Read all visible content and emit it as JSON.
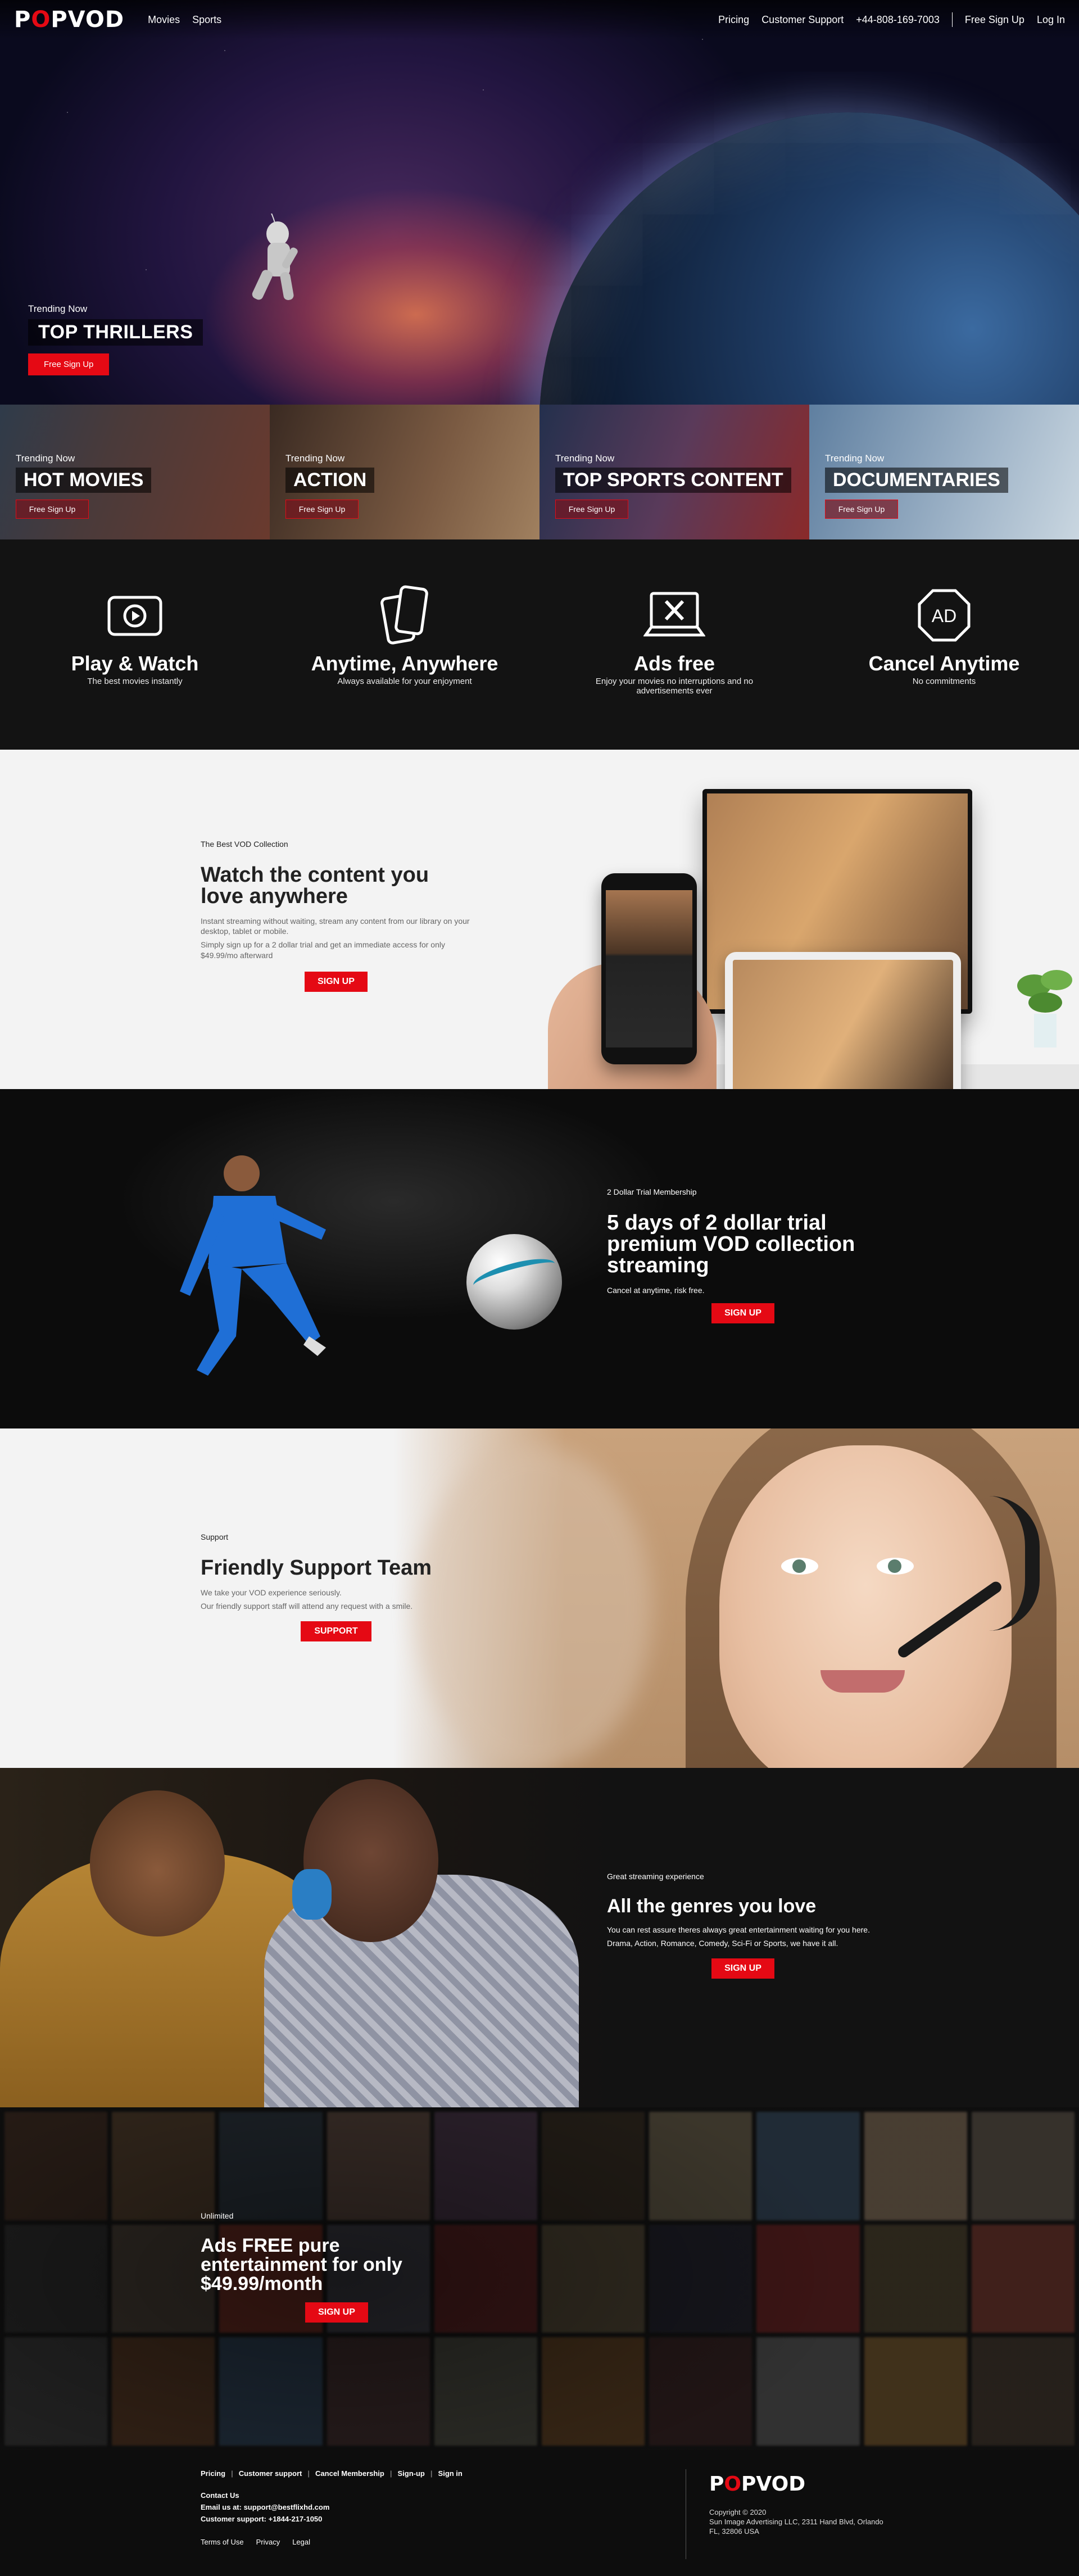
{
  "nav": {
    "logo_before": "P",
    "logo_o": "O",
    "logo_after": "PVOD",
    "links": [
      "Movies",
      "Sports"
    ],
    "right": {
      "pricing": "Pricing",
      "support": "Customer Support",
      "phone": "+44-808-169-7003",
      "signup": "Free Sign Up",
      "login": "Log In"
    }
  },
  "hero": {
    "label": "Trending Now",
    "title": "TOP THRILLERS",
    "button": "Free Sign Up"
  },
  "categories": [
    {
      "label": "Trending Now",
      "title": "HOT MOVIES",
      "button": "Free Sign Up",
      "colors": [
        "#2f3b4a",
        "#6a3a2e"
      ]
    },
    {
      "label": "Trending Now",
      "title": "ACTION",
      "button": "Free Sign Up",
      "colors": [
        "#3a2a22",
        "#a0805f"
      ]
    },
    {
      "label": "Trending Now",
      "title": "TOP SPORTS CONTENT",
      "button": "Free Sign Up",
      "colors": [
        "#24304d",
        "#8a2a2a"
      ]
    },
    {
      "label": "Trending Now",
      "title": "DOCUMENTARIES",
      "button": "Free Sign Up",
      "colors": [
        "#5f7fa0",
        "#c9d6e0"
      ]
    }
  ],
  "features": [
    {
      "icon": "play-icon",
      "title": "Play & Watch",
      "sub": "The best movies instantly"
    },
    {
      "icon": "devices-icon",
      "title": "Anytime, Anywhere",
      "sub": "Always available for your enjoyment"
    },
    {
      "icon": "no-ads-icon",
      "title": "Ads free",
      "sub": "Enjoy your movies no interruptions and no advertisements ever"
    },
    {
      "icon": "ad-octagon-icon",
      "title": "Cancel Anytime",
      "sub": "No commitments"
    }
  ],
  "section_content": {
    "eyebrow": "The Best VOD Collection",
    "heading": "Watch the content you love anywhere",
    "p1": "Instant streaming without waiting, stream any content from our library on your desktop, tablet or mobile.",
    "p2": "Simply sign up for a 2 dollar trial and get an immediate access for only $49.99/mo afterward",
    "button": "SIGN UP"
  },
  "section_trial": {
    "eyebrow": "2 Dollar Trial Membership",
    "heading": "5 days of 2 dollar trial premium VOD collection streaming",
    "p1": "Cancel at anytime, risk free.",
    "button": "SIGN UP"
  },
  "section_support": {
    "eyebrow": "Support",
    "heading": "Friendly Support Team",
    "p1": "We take your VOD experience seriously.",
    "p2": "Our friendly support staff will attend any request with a smile.",
    "button": "SUPPORT"
  },
  "section_genres": {
    "eyebrow": "Great streaming experience",
    "heading": "All the genres you love",
    "p1": "You can rest assure theres always great entertainment waiting for you here.",
    "p2": "Drama, Action, Romance, Comedy, Sci-Fi or Sports, we have it all.",
    "button": "SIGN UP"
  },
  "section_unlimited": {
    "eyebrow": "Unlimited",
    "heading": "Ads FREE pure entertainment for only $49.99/month",
    "button": "SIGN UP"
  },
  "footer": {
    "links": [
      "Pricing",
      "Customer support",
      "Cancel Membership",
      "Sign-up",
      "Sign in"
    ],
    "contact_heading": "Contact Us",
    "email": "Email us at: support@bestflixhd.com",
    "phone": "Customer support: +1844-217-1050",
    "legal": [
      "Terms of Use",
      "Privacy",
      "Legal"
    ],
    "copyright": "Copyright © 2020",
    "address1": "Sun Image Advertising LLC, 2311 Hand Blvd, Orlando",
    "address2": "FL, 32806 USA"
  },
  "colors": {
    "accent": "#e50914",
    "dark": "#121212",
    "light": "#f3f3f3"
  }
}
